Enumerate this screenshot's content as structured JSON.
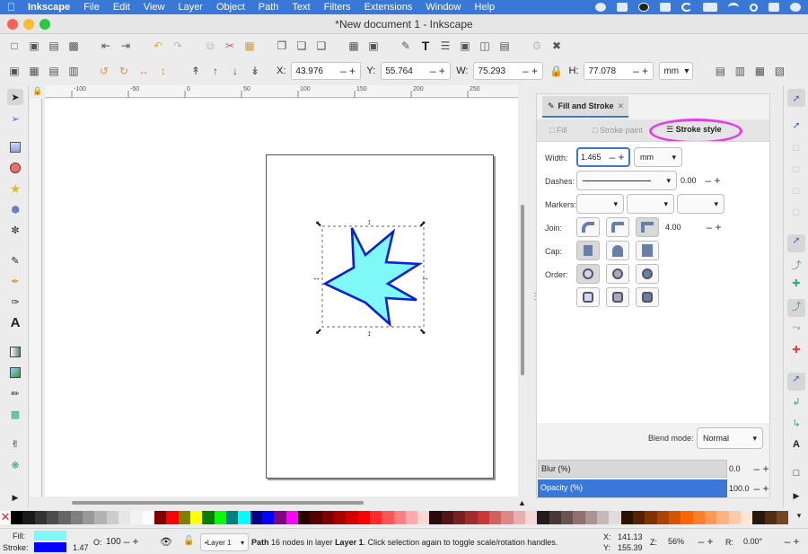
{
  "menubar": {
    "app_name": "Inkscape",
    "items": [
      "File",
      "Edit",
      "View",
      "Layer",
      "Object",
      "Path",
      "Text",
      "Filters",
      "Extensions",
      "Window",
      "Help"
    ]
  },
  "window": {
    "title": "*New document 1 - Inkscape"
  },
  "toolbar": {
    "x_label": "X:",
    "x_value": "43.976",
    "y_label": "Y:",
    "y_value": "55.764",
    "w_label": "W:",
    "w_value": "75.293",
    "h_label": "H:",
    "h_value": "77.078",
    "unit": "mm"
  },
  "ruler": {
    "ticks": [
      "-100",
      "-50",
      "0",
      "50",
      "100",
      "150",
      "200",
      "250"
    ]
  },
  "dock": {
    "panel_title": "Fill and Stroke",
    "tabs": {
      "fill": "Fill",
      "stroke_paint": "Stroke paint",
      "stroke_style": "Stroke style"
    },
    "width_label": "Width:",
    "width_value": "1.465",
    "width_unit": "mm",
    "dashes_label": "Dashes:",
    "dash_offset": "0.00",
    "markers_label": "Markers:",
    "join_label": "Join:",
    "miter_limit": "4.00",
    "cap_label": "Cap:",
    "order_label": "Order:",
    "blend_label": "Blend mode:",
    "blend_value": "Normal",
    "blur_label": "Blur (%)",
    "blur_value": "0.0",
    "opacity_label": "Opacity (%)",
    "opacity_value": "100.0"
  },
  "colors": {
    "menubar": "#3a78d8",
    "accent": "#3a78d8",
    "star_fill": "#7ff8f8",
    "star_stroke": "#0a1fd8",
    "highlight_ellipse": "#e040e8"
  },
  "palette": [
    "#000000",
    "#1a1a1a",
    "#333333",
    "#4d4d4d",
    "#666666",
    "#808080",
    "#999999",
    "#b3b3b3",
    "#cccccc",
    "#e6e6e6",
    "#f2f2f2",
    "#ffffff",
    "#800000",
    "#ff0000",
    "#808000",
    "#ffff00",
    "#008000",
    "#00ff00",
    "#008080",
    "#00ffff",
    "#000080",
    "#0000ff",
    "#800080",
    "#ff00ff",
    "#2b0000",
    "#550000",
    "#800000",
    "#aa0000",
    "#d40000",
    "#ff0000",
    "#ff2a2a",
    "#ff5555",
    "#ff8080",
    "#ffaaaa",
    "#ffd5d5",
    "#280b0b",
    "#501616",
    "#782121",
    "#a02c2c",
    "#c83737",
    "#d35f5f",
    "#de8787",
    "#e9afaf",
    "#f4d7d7",
    "#241c1c",
    "#483737",
    "#6c5353",
    "#916f6f",
    "#ac9393",
    "#c8b7b7",
    "#e3dbdb",
    "#2b1100",
    "#552200",
    "#803300",
    "#aa4400",
    "#d45500",
    "#ff6600",
    "#ff7f2a",
    "#ff9955",
    "#ffb380",
    "#ffccaa",
    "#ffe6d5",
    "#28170b",
    "#502d16",
    "#784421"
  ],
  "statusbar": {
    "fill_label": "Fill:",
    "stroke_label": "Stroke:",
    "fill_color": "#7ff8f8",
    "stroke_color": "#0000ff",
    "stroke_width": "1.47",
    "opacity_label": "O:",
    "opacity_value": "100",
    "layer": "•Layer 1",
    "message_bold_start": "Path",
    "message_mid": " 16 nodes in layer ",
    "message_bold_layer": "Layer 1",
    "message_end": ". Click selection again to toggle scale/rotation handles.",
    "cursor_x_label": "X:",
    "cursor_x": "141.13",
    "cursor_y_label": "Y:",
    "cursor_y": "155.39",
    "zoom_label": "Z:",
    "zoom_value": "56%",
    "rotation_label": "R:",
    "rotation_value": "0.00°"
  }
}
